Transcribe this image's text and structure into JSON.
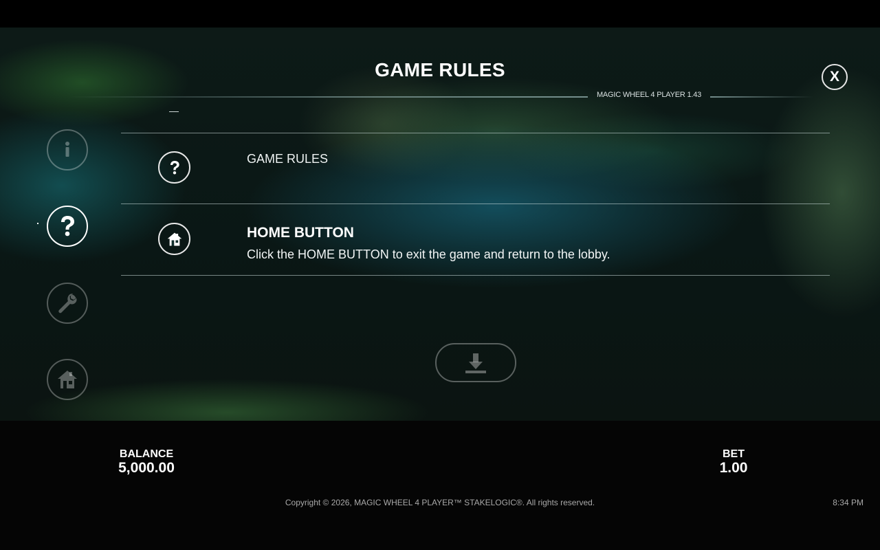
{
  "header": {
    "title": "GAME RULES",
    "version": "MAGIC WHEEL 4 PLAYER 1.43",
    "close_label": "X"
  },
  "sidebar": {
    "items": [
      {
        "icon": "info-icon",
        "active": false
      },
      {
        "icon": "question-icon",
        "active": true
      },
      {
        "icon": "wrench-icon",
        "active": false
      },
      {
        "icon": "home-icon",
        "active": false
      }
    ]
  },
  "rules": {
    "rows": [
      {
        "icon": "question-icon",
        "title": "GAME RULES"
      },
      {
        "icon": "home-icon",
        "title": "HOME BUTTON",
        "description": "Click the HOME BUTTON to exit the game and return to the lobby."
      }
    ],
    "download_icon": "download-icon"
  },
  "footer": {
    "balance_label": "BALANCE",
    "balance_value": "5,000.00",
    "bet_label": "BET",
    "bet_value": "1.00",
    "copyright": "Copyright © 2026, MAGIC WHEEL 4 PLAYER™ STAKELOGIC®. All rights reserved.",
    "time": "8:34 PM"
  },
  "colors": {
    "accent": "#ffffff",
    "footer_bg": "#050505",
    "muted_text": "#a9a9a9"
  }
}
